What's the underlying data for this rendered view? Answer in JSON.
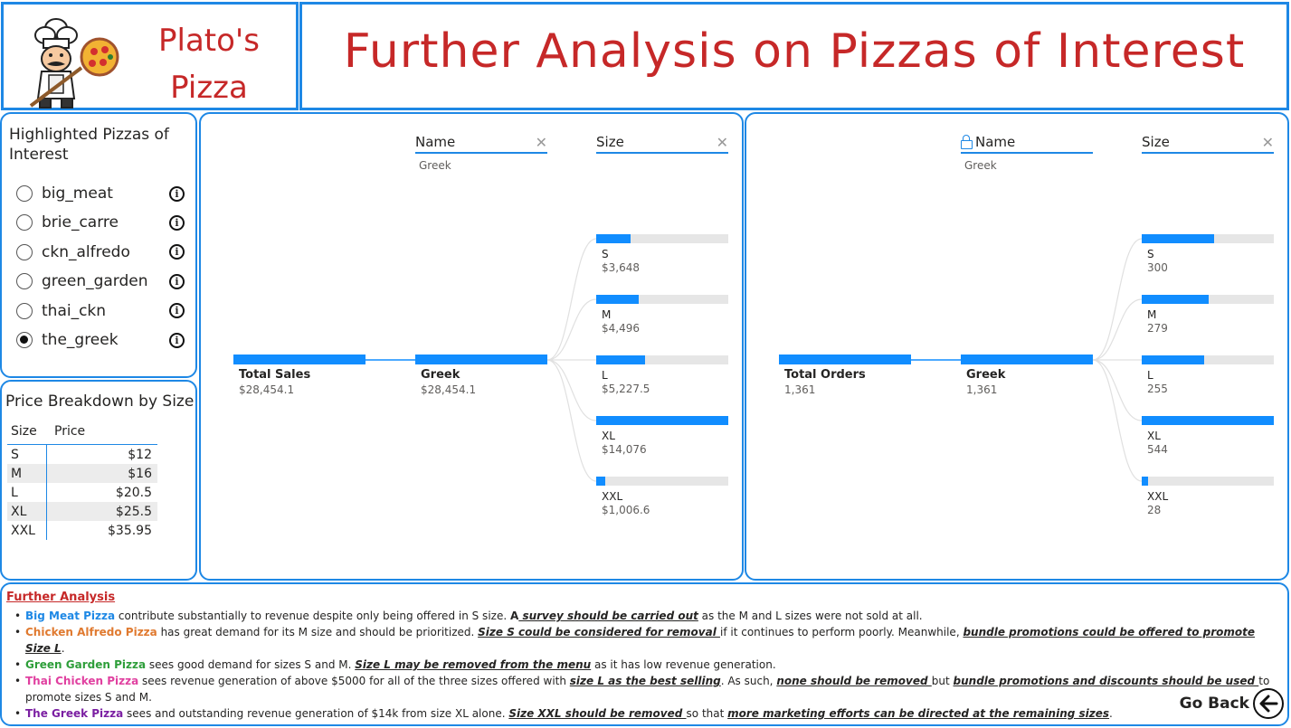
{
  "header": {
    "brand_line1": "Plato's",
    "brand_line2": "Pizza",
    "title": "Further Analysis on Pizzas of Interest"
  },
  "slicer": {
    "title": "Highlighted Pizzas of Interest",
    "options": [
      {
        "label": "big_meat",
        "selected": false
      },
      {
        "label": "brie_carre",
        "selected": false
      },
      {
        "label": "ckn_alfredo",
        "selected": false
      },
      {
        "label": "green_garden",
        "selected": false
      },
      {
        "label": "thai_ckn",
        "selected": false
      },
      {
        "label": "the_greek",
        "selected": true
      }
    ]
  },
  "price_table": {
    "title": "Price Breakdown by Size",
    "col_size": "Size",
    "col_price": "Price",
    "rows": [
      {
        "size": "S",
        "price": "$12"
      },
      {
        "size": "M",
        "price": "$16"
      },
      {
        "size": "L",
        "price": "$20.5"
      },
      {
        "size": "XL",
        "price": "$25.5"
      },
      {
        "size": "XXL",
        "price": "$35.95"
      }
    ]
  },
  "tree_sales": {
    "filter_name_label": "Name",
    "filter_name_value": "Greek",
    "filter_size_label": "Size",
    "root_label": "Total Sales",
    "root_value": "$28,454.1",
    "mid_label": "Greek",
    "mid_value": "$28,454.1",
    "leaves": [
      {
        "name": "S",
        "value": "$3,648",
        "fraction": 0.26
      },
      {
        "name": "M",
        "value": "$4,496",
        "fraction": 0.32
      },
      {
        "name": "L",
        "value": "$5,227.5",
        "fraction": 0.37
      },
      {
        "name": "XL",
        "value": "$14,076",
        "fraction": 1.0
      },
      {
        "name": "XXL",
        "value": "$1,006.6",
        "fraction": 0.07
      }
    ]
  },
  "tree_orders": {
    "filter_name_label": "Name",
    "filter_name_value": "Greek",
    "filter_size_label": "Size",
    "root_label": "Total Orders",
    "root_value": "1,361",
    "mid_label": "Greek",
    "mid_value": "1,361",
    "leaves": [
      {
        "name": "S",
        "value": "300",
        "fraction": 0.55
      },
      {
        "name": "M",
        "value": "279",
        "fraction": 0.51
      },
      {
        "name": "L",
        "value": "255",
        "fraction": 0.47
      },
      {
        "name": "XL",
        "value": "544",
        "fraction": 1.0
      },
      {
        "name": "XXL",
        "value": "28",
        "fraction": 0.05
      }
    ]
  },
  "notes": {
    "title": "Further Analysis",
    "items": [
      {
        "parts": [
          {
            "t": "Big Meat Pizza",
            "c": "kw",
            "color": "#1e88e5"
          },
          {
            "t": " contribute substantially to revenue despite only being offered in S size. "
          },
          {
            "t": "A",
            "c": "kw"
          },
          {
            "t": " survey should be carried out",
            "c": "em"
          },
          {
            "t": " as the M and L sizes were not sold at all."
          }
        ]
      },
      {
        "parts": [
          {
            "t": "Chicken Alfredo Pizza",
            "c": "kw",
            "color": "#e07a30"
          },
          {
            "t": " has great demand for its M size and should be prioritized. "
          },
          {
            "t": "Size S could be considered for removal ",
            "c": "em"
          },
          {
            "t": "if it continues to perform poorly. Meanwhile, "
          },
          {
            "t": "bundle promotions could be offered to promote Size L",
            "c": "em"
          },
          {
            "t": "."
          }
        ]
      },
      {
        "parts": [
          {
            "t": "Green Garden Pizza",
            "c": "kw",
            "color": "#2e9e3a"
          },
          {
            "t": " sees good demand for sizes S and M. "
          },
          {
            "t": "Size L may be removed from the menu",
            "c": "em"
          },
          {
            "t": " as it has low revenue generation."
          }
        ]
      },
      {
        "parts": [
          {
            "t": "Thai Chicken Pizza",
            "c": "kw",
            "color": "#e040a0"
          },
          {
            "t": " sees revenue generation of above $5000 for all of the three sizes offered with "
          },
          {
            "t": "size L as the best selling",
            "c": "em"
          },
          {
            "t": ". As such, "
          },
          {
            "t": "none should be removed ",
            "c": "em"
          },
          {
            "t": "but "
          },
          {
            "t": "bundle promotions and discounts should be used ",
            "c": "em"
          },
          {
            "t": "to promote sizes S and M."
          }
        ]
      },
      {
        "parts": [
          {
            "t": "The Greek Pizza",
            "c": "kw",
            "color": "#7b1fa2"
          },
          {
            "t": " sees and outstanding revenue generation of $14k from size XL alone.  "
          },
          {
            "t": "Size XXL should be removed ",
            "c": "em"
          },
          {
            "t": "so that "
          },
          {
            "t": "more marketing efforts can be directed at the remaining sizes",
            "c": "em"
          },
          {
            "t": "."
          }
        ]
      }
    ],
    "go_back_label": "Go Back"
  },
  "colors": {
    "accent": "#1e88e5",
    "bar": "#118dff",
    "title_red": "#c62828"
  }
}
